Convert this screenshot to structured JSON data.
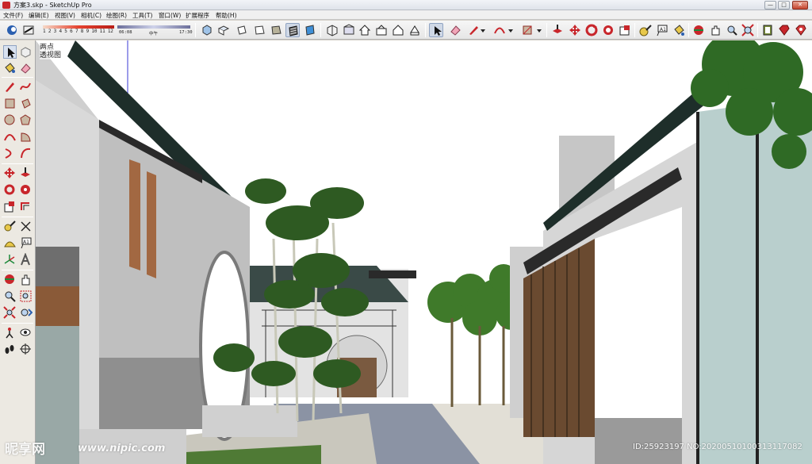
{
  "window": {
    "title": "方案3.skp - SketchUp Pro",
    "minimize_label": "—",
    "maximize_label": "□",
    "close_label": "✕"
  },
  "menu": [
    {
      "label": "文件(F)"
    },
    {
      "label": "编辑(E)"
    },
    {
      "label": "视图(V)"
    },
    {
      "label": "相机(C)"
    },
    {
      "label": "绘图(R)"
    },
    {
      "label": "工具(T)"
    },
    {
      "label": "窗口(W)"
    },
    {
      "label": "扩展程序"
    },
    {
      "label": "帮助(H)"
    }
  ],
  "shadow_settings": {
    "month_scale": "1 2 3 4 5 6 7 8 9 10 11 12",
    "time_start": "06:08",
    "time_noon": "中午",
    "time_end": "17:30"
  },
  "toolbar_icons": [
    "shadow-toggle-icon",
    "fog-toggle-icon",
    "iso-view-icon",
    "top-view-icon",
    "front-view-icon",
    "right-view-icon",
    "back-view-icon",
    "left-view-icon",
    "xray-icon",
    "wireframe-icon",
    "hidden-line-icon",
    "shaded-icon",
    "shaded-textures-icon",
    "monochrome-icon",
    "warehouse-icon",
    "extension-icon",
    "house-icon",
    "share-icon",
    "house-outline-icon",
    "component-icon",
    "select-arrow-icon",
    "eraser-icon",
    "pencil-icon",
    "arc-icon",
    "rectangle-icon",
    "push-pull-icon",
    "move-icon",
    "rotate-icon",
    "scale-icon",
    "tape-measure-icon",
    "text-icon",
    "paint-bucket-icon",
    "orbit-icon",
    "pan-icon",
    "zoom-icon",
    "zoom-extents-icon",
    "scenes-icon",
    "ruby-icon",
    "extension-warehouse-icon"
  ],
  "left_tool_icons": [
    "select-icon",
    "component-icon",
    "paint-bucket-icon",
    "eraser-icon",
    "line-icon",
    "freehand-icon",
    "rectangle-icon",
    "rotated-rectangle-icon",
    "circle-icon",
    "polygon-icon",
    "arc-icon",
    "pie-icon",
    "move-icon",
    "push-pull-icon",
    "rotate-icon",
    "follow-me-icon",
    "scale-icon",
    "offset-icon",
    "tape-measure-icon",
    "dimension-icon",
    "protractor-icon",
    "text-icon",
    "axes-icon",
    "3d-text-icon",
    "orbit-icon",
    "pan-icon",
    "zoom-icon",
    "zoom-window-icon",
    "zoom-extents-icon",
    "previous-view-icon",
    "position-camera-icon",
    "look-around-icon",
    "walk-icon",
    "section-plane-icon"
  ],
  "viewport": {
    "scene_tab_1": "两点",
    "scene_tab_2": "透视图"
  },
  "watermark": {
    "logo": "昵享网",
    "url": "www.nipic.com",
    "id_text": "ID:25923197 NO:20200510100313117082"
  },
  "colors": {
    "roof": "#1f2f2b",
    "wall": "#b7b7b7",
    "sky": "#ffffff",
    "toolbar_bg": "#e8e8e8",
    "accent_red": "#c8262b"
  }
}
